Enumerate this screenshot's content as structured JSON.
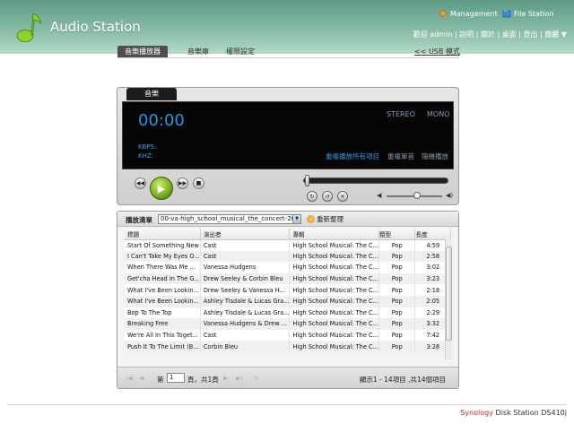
{
  "app": {
    "title": "Audio Station"
  },
  "header": {
    "management_label": "Management",
    "file_station_label": "File Station",
    "user_links": [
      "歡迎 admin",
      "說明",
      "關於",
      "桌面",
      "登出",
      "簡體 ▼"
    ]
  },
  "tabs": [
    {
      "label": "音樂播放器",
      "active": true
    },
    {
      "label": "音樂庫",
      "active": false
    },
    {
      "label": "權限設定",
      "active": false
    }
  ],
  "usb_mode_label": "<< USB 模式",
  "player": {
    "tab_label": "音樂",
    "time": "00:00",
    "stereo_label": "STEREO",
    "mono_label": "MONO",
    "kbps_label": "KBPS:",
    "khz_label": "KHZ:",
    "modes": [
      {
        "label": "重複播放所有項目",
        "color": "#2f9be6"
      },
      {
        "label": "重複單首",
        "color": "#8a9aa8"
      },
      {
        "label": "隨機播放",
        "color": "#8a9aa8"
      }
    ],
    "volume_level": 0.55
  },
  "playlist": {
    "label": "播放清單",
    "selected": "00-va-high_school_musical_the_concert-2007",
    "refresh_label": "重新整理",
    "columns": [
      "標題",
      "演出者",
      "專輯",
      "類型",
      "長度"
    ],
    "rows": [
      [
        "Start Of Something New",
        "Cast",
        "High School Musical: The C...",
        "Pop",
        "4:59"
      ],
      [
        "I Can't Take My Eyes O...",
        "Cast",
        "High School Musical: The C...",
        "Pop",
        "2:58"
      ],
      [
        "When There Was Me ...",
        "Vanessa Hudgens",
        "High School Musical: The C...",
        "Pop",
        "3:02"
      ],
      [
        "Get'cha Head In The G...",
        "Drew Seeley & Corbin Bleu",
        "High School Musical: The C...",
        "Pop",
        "3:23"
      ],
      [
        "What I've Been Lookin...",
        "Drew Seeley & Vanessa H...",
        "High School Musical: The C...",
        "Pop",
        "2:18"
      ],
      [
        "What I've Been Lookin...",
        "Ashley Tisdale & Lucas Gra...",
        "High School Musical: The C...",
        "Pop",
        "2:05"
      ],
      [
        "Bop To The Top",
        "Ashley Tisdale & Lucas Gra...",
        "High School Musical: The C...",
        "Pop",
        "2:29"
      ],
      [
        "Breaking Free",
        "Vanessa Hudgens & Drew ...",
        "High School Musical: The C...",
        "Pop",
        "3:32"
      ],
      [
        "We're All In This Toget...",
        "Cast",
        "High School Musical: The C...",
        "Pop",
        "7:42"
      ],
      [
        "Push It To The Limit (B...",
        "Corbin Bleu",
        "High School Musical: The C...",
        "Pop",
        "3:28"
      ]
    ]
  },
  "pager": {
    "page_prefix": "第",
    "page_value": "1",
    "page_suffix": "頁，共1頁",
    "summary": "顯示1 - 14項目 ,共14個項目"
  },
  "footer": {
    "brand": "Synology",
    "product": "Disk Station DS410j"
  }
}
